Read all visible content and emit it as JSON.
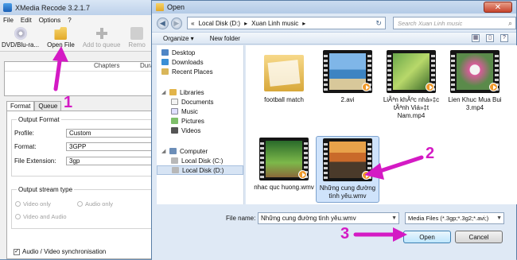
{
  "xmedia": {
    "title": "XMedia Recode 3.2.1.7",
    "menu": [
      "File",
      "Edit",
      "Options",
      "?"
    ],
    "toolbar": {
      "dvd": "DVD/Blu-ra...",
      "open_file": "Open File",
      "add_queue": "Add to queue",
      "remove": "Remo"
    },
    "list_headers": [
      "Chapters",
      "Durati"
    ],
    "tabs": [
      "Format",
      "Queue"
    ],
    "output_format": {
      "title": "Output Format",
      "profile_label": "Profile:",
      "profile_value": "Custom",
      "format_label": "Format:",
      "format_value": "3GPP",
      "ext_label": "File Extension:",
      "ext_value": "3gp"
    },
    "stream": {
      "title": "Output stream type",
      "video_only": "Video only",
      "audio_only": "Audio only",
      "video_audio": "Video and Audio"
    },
    "sync_label": "Audio / Video synchronisation"
  },
  "dialog": {
    "title": "Open",
    "breadcrumb": [
      "Local Disk (D:)",
      "Xuan Linh music"
    ],
    "search_placeholder": "Search Xuan Linh music",
    "organize": "Organize ▾",
    "new_folder": "New folder",
    "nav": {
      "favorites": [
        "Desktop",
        "Downloads",
        "Recent Places"
      ],
      "libraries": "Libraries",
      "library_items": [
        "Documents",
        "Music",
        "Pictures",
        "Videos"
      ],
      "computer": "Computer",
      "drives": [
        "Local Disk (C:)",
        "Local Disk (D:)"
      ]
    },
    "files": [
      {
        "name": "football match"
      },
      {
        "name": "2.avi"
      },
      {
        "name": "LiÃªn khÃºc nhá»‡c tÃªnh Viá»‡t Nam.mp4"
      },
      {
        "name": "Lien Khuc Mua Bui 3.mp4"
      },
      {
        "name": "nhac quc huong.wmv"
      },
      {
        "name": "Những cung đường tình yêu.wmv"
      }
    ],
    "file_name_label": "File name:",
    "file_name_value": "Những cung đường tình yêu.wmv",
    "filter_value": "Media Files (*.3gp;*.3g2;*.avi;)",
    "open_button": "Open",
    "cancel_button": "Cancel"
  },
  "annotations": [
    "1",
    "2",
    "3"
  ],
  "colors": {
    "annotation": "#d41ac4",
    "dialog_bg": "#dfe9f5",
    "selection": "#cfe3fb"
  }
}
